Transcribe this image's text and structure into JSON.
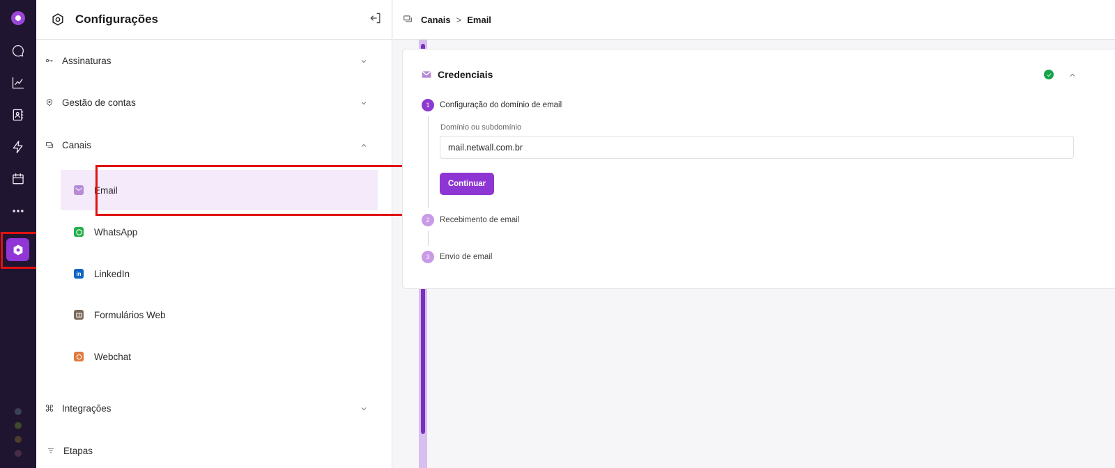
{
  "sidebar": {
    "title": "Configurações",
    "sections": {
      "assinaturas": "Assinaturas",
      "gestao": "Gestão de contas",
      "canais": "Canais",
      "integracoes": "Integrações",
      "etapas": "Etapas"
    },
    "channels": [
      {
        "label": "Email",
        "icon": "email-icon",
        "color": "#b58ad6"
      },
      {
        "label": "WhatsApp",
        "icon": "whatsapp-icon",
        "color": "#25b04a"
      },
      {
        "label": "LinkedIn",
        "icon": "linkedin-icon",
        "color": "#0a66c2"
      },
      {
        "label": "Formulários Web",
        "icon": "web-form-icon",
        "color": "#7a6a5a"
      },
      {
        "label": "Webchat",
        "icon": "webchat-icon",
        "color": "#e07a3c"
      }
    ]
  },
  "breadcrumb": {
    "parent": "Canais",
    "separator": ">",
    "current": "Email"
  },
  "card": {
    "title": "Credenciais",
    "steps": [
      {
        "number": "1",
        "label": "Configuração do domínio de email"
      },
      {
        "number": "2",
        "label": "Recebimento de email"
      },
      {
        "number": "3",
        "label": "Envio de email"
      }
    ],
    "field_label": "Domínio ou subdomínio",
    "field_value": "mail.netwall.com.br",
    "button_label": "Continuar"
  },
  "colors": {
    "accent": "#8e36d3",
    "rail_bg": "#1f1530",
    "success": "#16a34a",
    "highlight": "#e11010"
  }
}
